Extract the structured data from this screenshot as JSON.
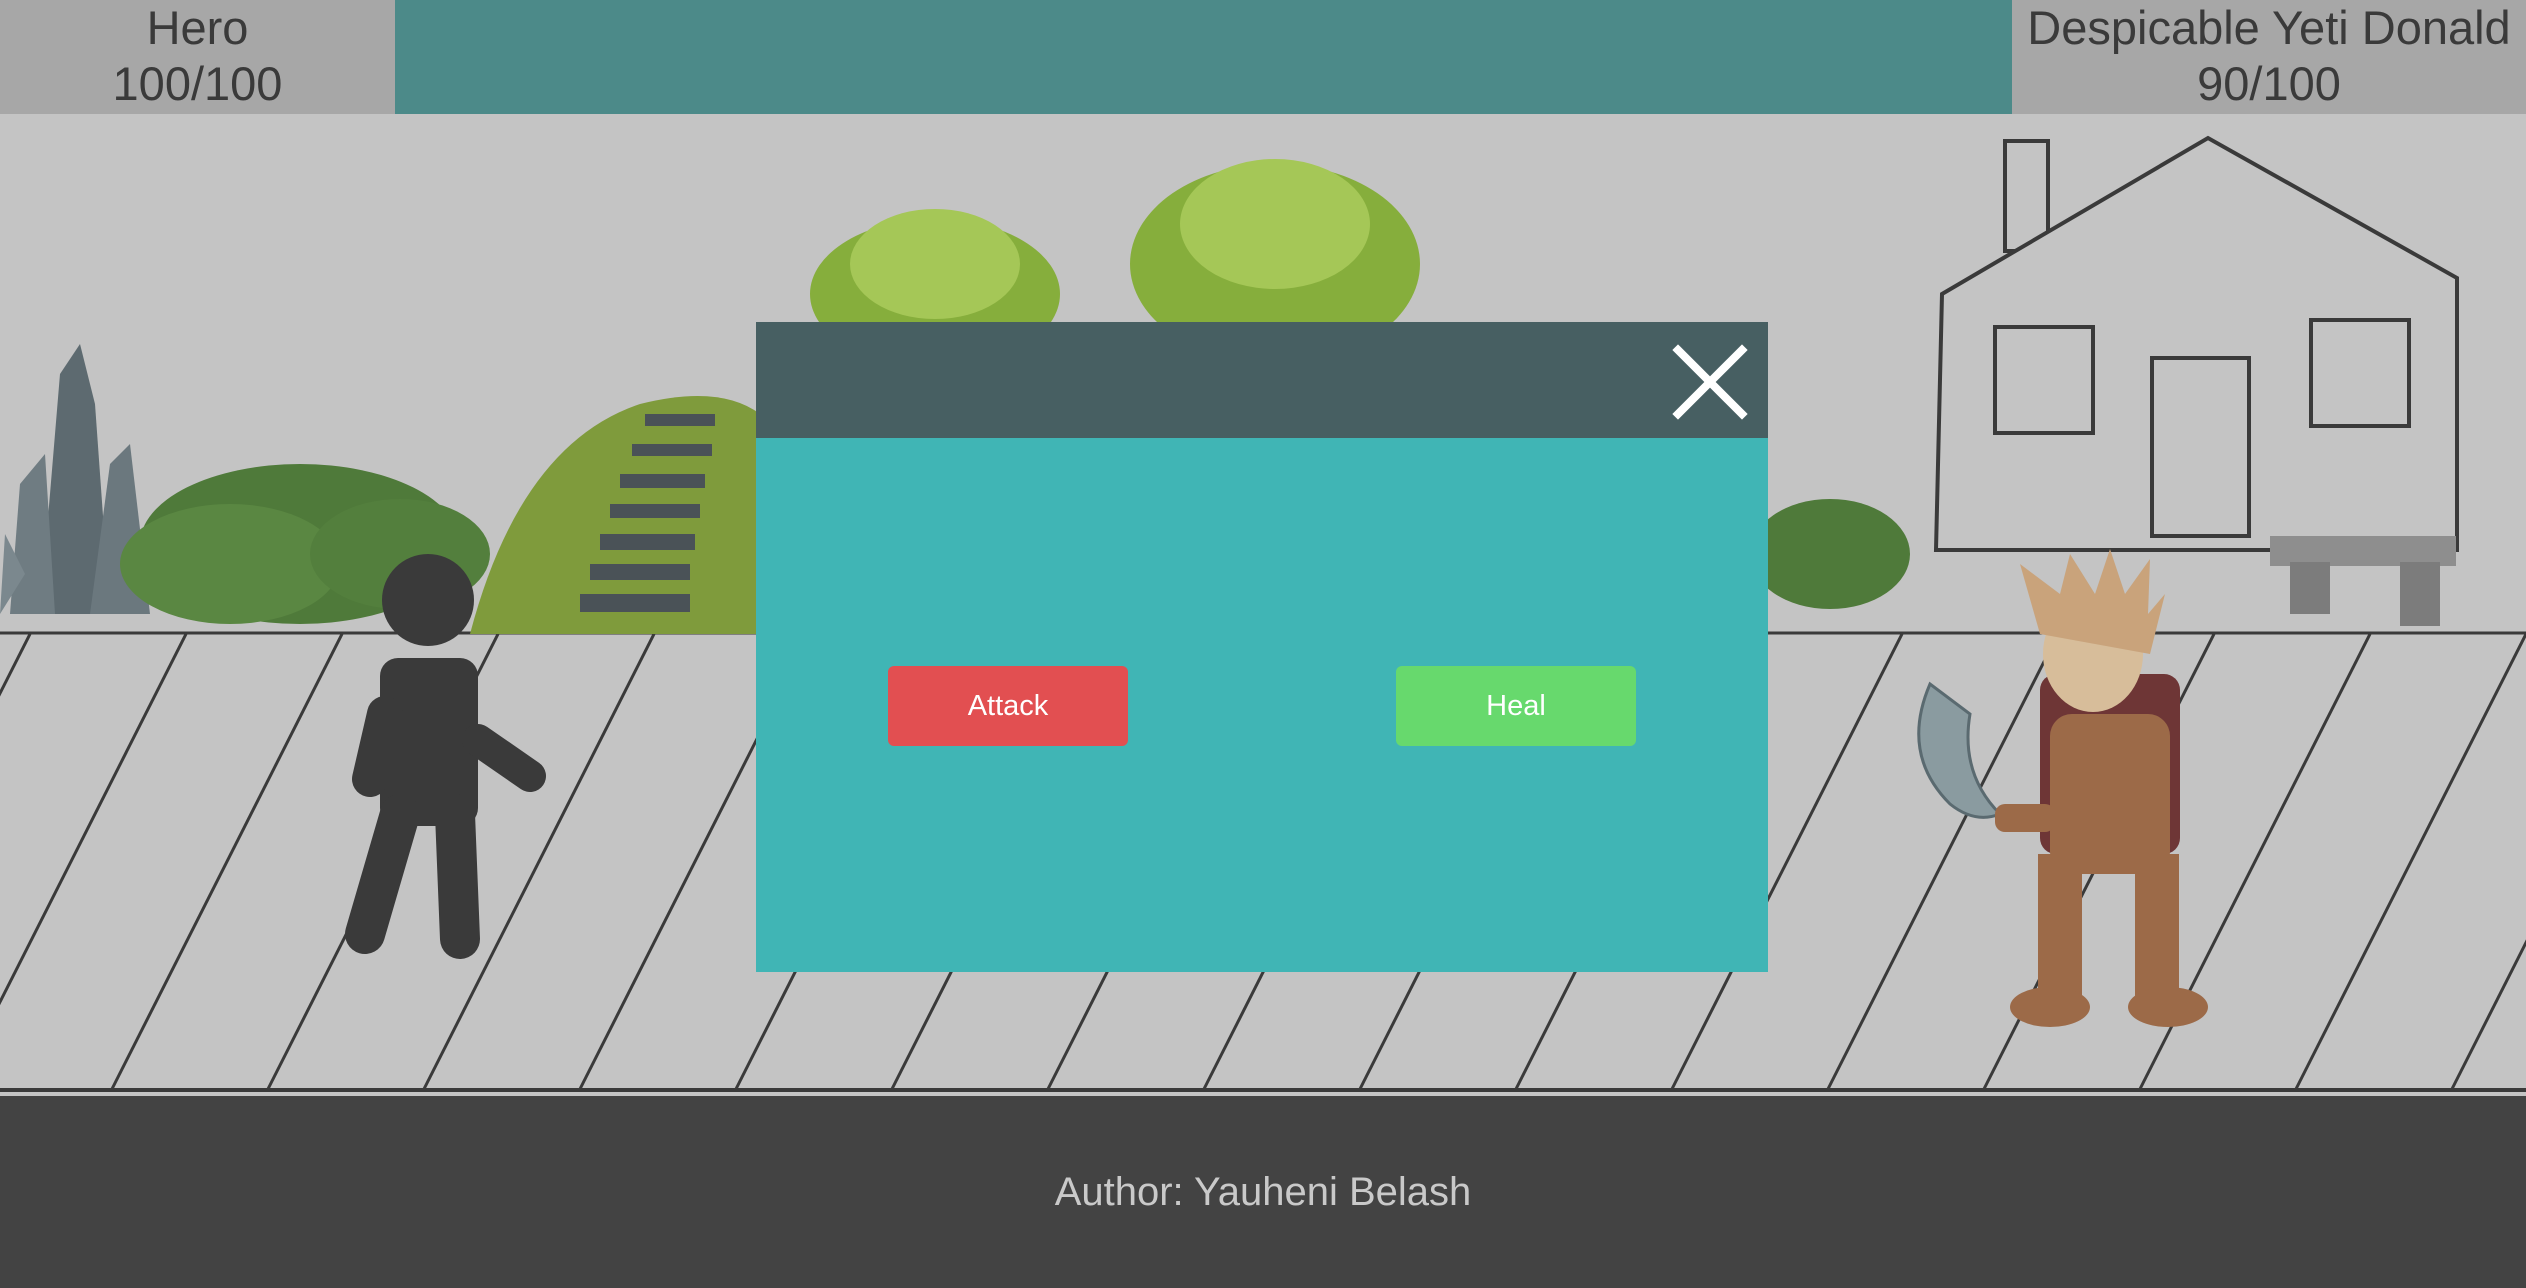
{
  "hud": {
    "player": {
      "name": "Hero",
      "hp": "100/100"
    },
    "enemy": {
      "name": "Despicable Yeti Donald",
      "hp": "90/100"
    }
  },
  "modal": {
    "attack_label": "Attack",
    "heal_label": "Heal",
    "close_icon": "close-icon"
  },
  "footer": {
    "author": "Author: Yauheni Belash"
  },
  "colors": {
    "hud_panel": "#a7a7a7",
    "hud_bar": "#4c8a89",
    "modal_header": "#475f62",
    "modal_body": "#40b5b5",
    "attack": "#e24f51",
    "heal": "#67d96d",
    "footer": "#434343"
  }
}
